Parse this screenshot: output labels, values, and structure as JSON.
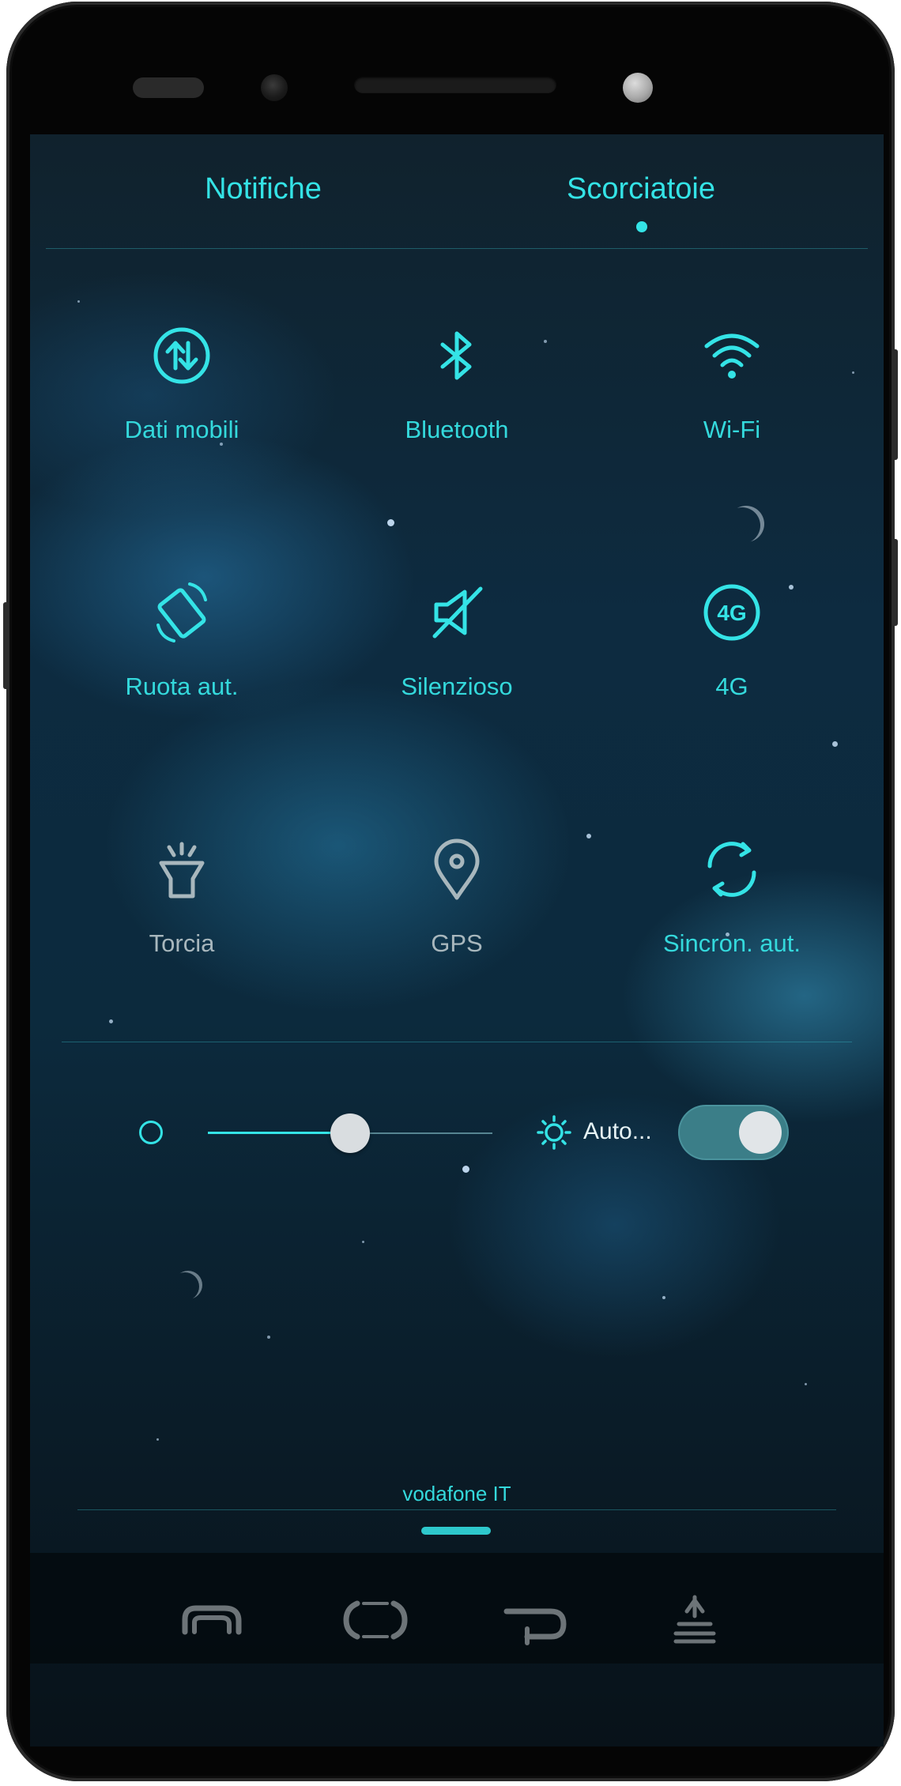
{
  "tabs": [
    {
      "label": "Notifiche",
      "active": false
    },
    {
      "label": "Scorciatoie",
      "active": true
    }
  ],
  "tiles": [
    {
      "label": "Dati mobili",
      "icon": "mobile-data-icon",
      "state": "on"
    },
    {
      "label": "Bluetooth",
      "icon": "bluetooth-icon",
      "state": "on"
    },
    {
      "label": "Wi-Fi",
      "icon": "wifi-icon",
      "state": "on"
    },
    {
      "label": "Ruota aut.",
      "icon": "auto-rotate-icon",
      "state": "on"
    },
    {
      "label": "Silenzioso",
      "icon": "silent-icon",
      "state": "on"
    },
    {
      "label": "4G",
      "icon": "4g-icon",
      "state": "on",
      "icon_text": "4G"
    },
    {
      "label": "Torcia",
      "icon": "flashlight-icon",
      "state": "off"
    },
    {
      "label": "GPS",
      "icon": "gps-icon",
      "state": "off"
    },
    {
      "label": "Sincron. aut.",
      "icon": "auto-sync-icon",
      "state": "on"
    }
  ],
  "brightness": {
    "level": 0.5,
    "auto_label": "Auto...",
    "auto_enabled": true
  },
  "carrier": "vodafone IT",
  "navbar": [
    {
      "icon": "menu-icon"
    },
    {
      "icon": "home-icon"
    },
    {
      "icon": "back-icon"
    },
    {
      "icon": "notification-shade-icon"
    }
  ],
  "colors": {
    "accent": "#34e3e6",
    "inactive": "#a8b7bd",
    "toggle_on": "#3b7e88"
  }
}
